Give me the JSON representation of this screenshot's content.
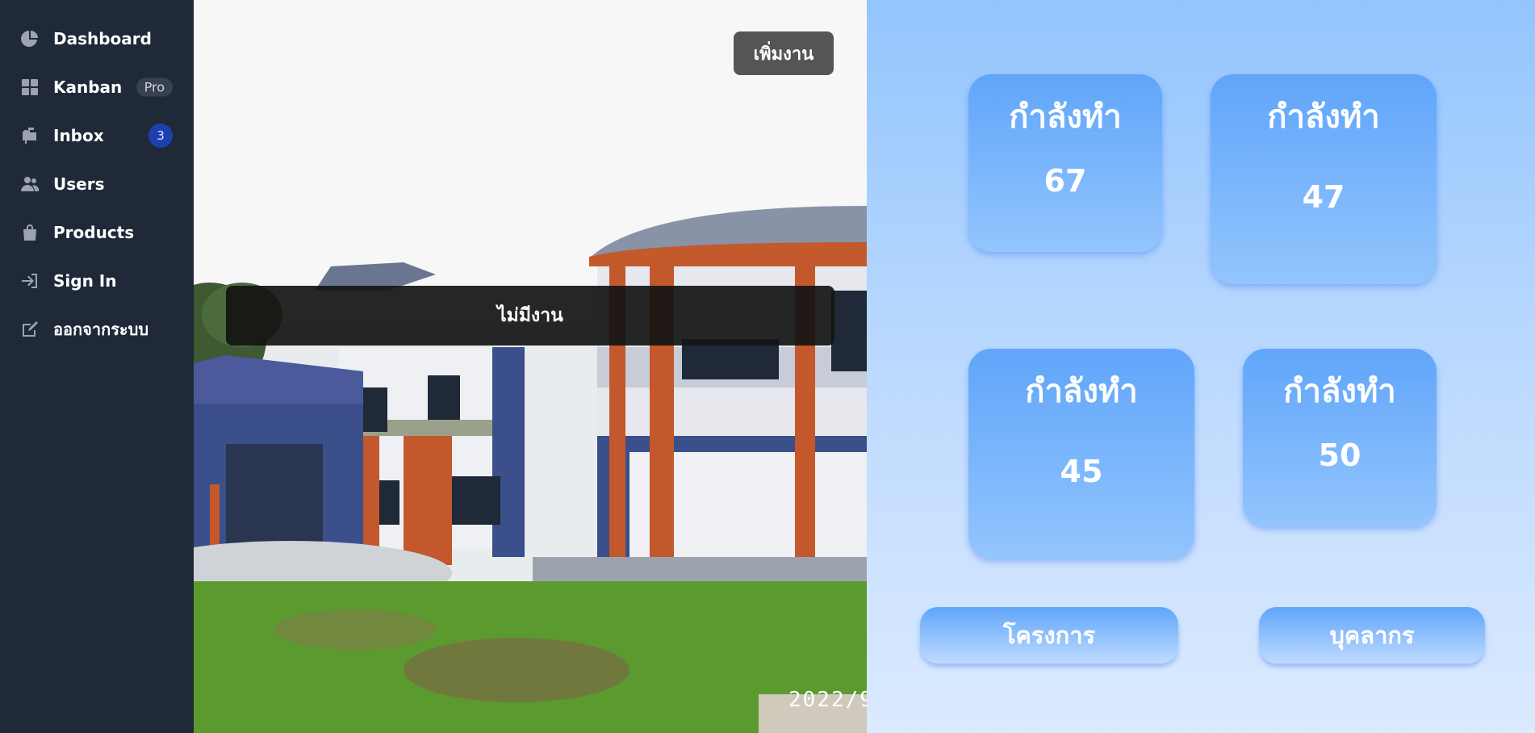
{
  "sidebar": {
    "items": [
      {
        "label": "Dashboard",
        "icon": "pie-chart-icon"
      },
      {
        "label": "Kanban",
        "icon": "grid-icon",
        "badge": "Pro"
      },
      {
        "label": "Inbox",
        "icon": "inbox-icon",
        "badge": "3"
      },
      {
        "label": "Users",
        "icon": "users-icon"
      },
      {
        "label": "Products",
        "icon": "shopping-bag-icon"
      },
      {
        "label": "Sign In",
        "icon": "sign-in-icon"
      },
      {
        "label": "ออกจากระบบ",
        "icon": "logout-icon"
      }
    ]
  },
  "photo": {
    "add_task_label": "เพิ่มงาน",
    "no_task_text": "ไม่มีงาน",
    "date_stamp": "2022/9"
  },
  "stats": [
    {
      "label": "กำลังทำ",
      "value": "67"
    },
    {
      "label": "กำลังทำ",
      "value": "47"
    },
    {
      "label": "กำลังทำ",
      "value": "45"
    },
    {
      "label": "กำลังทำ",
      "value": "50"
    }
  ],
  "actions": {
    "projects_label": "โครงการ",
    "personnel_label": "บุคลากร"
  },
  "colors": {
    "sidebar_bg": "#1f2937",
    "card_accent": "#60a5fa",
    "panel_bg": "#bfdbfe",
    "badge_blue": "#1e40af"
  }
}
